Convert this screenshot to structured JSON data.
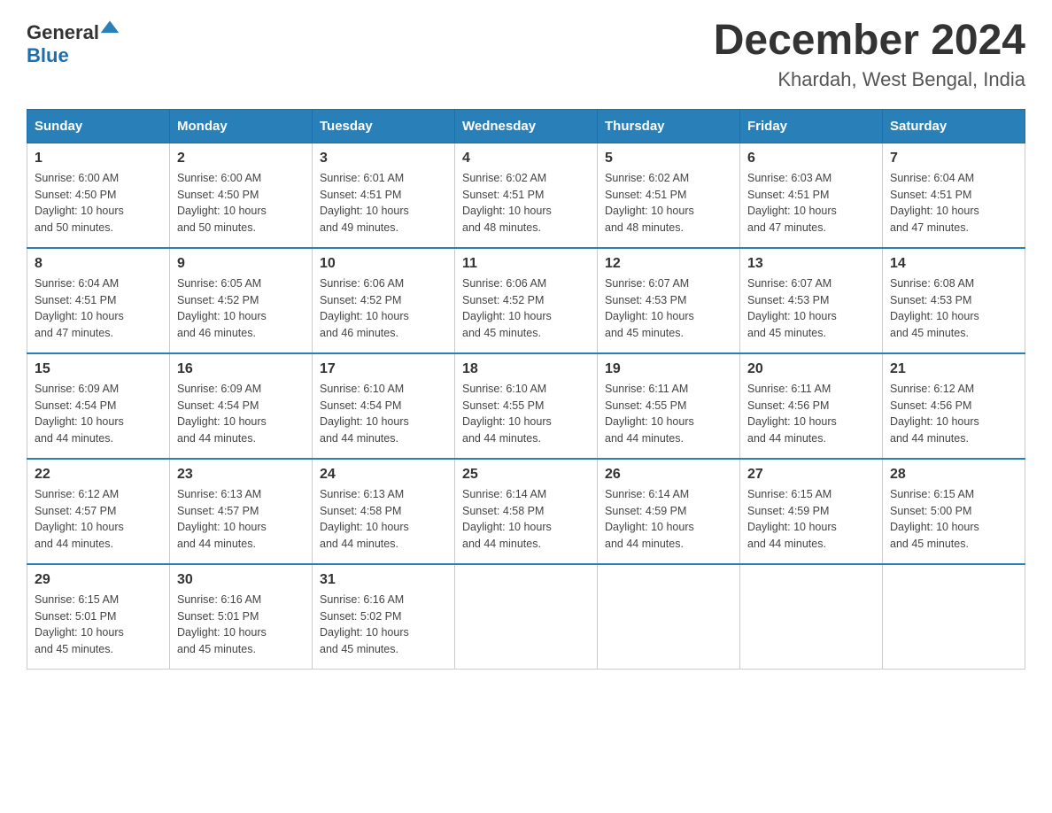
{
  "logo": {
    "general": "General",
    "blue": "Blue"
  },
  "title": "December 2024",
  "location": "Khardah, West Bengal, India",
  "weekdays": [
    "Sunday",
    "Monday",
    "Tuesday",
    "Wednesday",
    "Thursday",
    "Friday",
    "Saturday"
  ],
  "weeks": [
    [
      {
        "day": "1",
        "sunrise": "6:00 AM",
        "sunset": "4:50 PM",
        "daylight": "10 hours and 50 minutes."
      },
      {
        "day": "2",
        "sunrise": "6:00 AM",
        "sunset": "4:50 PM",
        "daylight": "10 hours and 50 minutes."
      },
      {
        "day": "3",
        "sunrise": "6:01 AM",
        "sunset": "4:51 PM",
        "daylight": "10 hours and 49 minutes."
      },
      {
        "day": "4",
        "sunrise": "6:02 AM",
        "sunset": "4:51 PM",
        "daylight": "10 hours and 48 minutes."
      },
      {
        "day": "5",
        "sunrise": "6:02 AM",
        "sunset": "4:51 PM",
        "daylight": "10 hours and 48 minutes."
      },
      {
        "day": "6",
        "sunrise": "6:03 AM",
        "sunset": "4:51 PM",
        "daylight": "10 hours and 47 minutes."
      },
      {
        "day": "7",
        "sunrise": "6:04 AM",
        "sunset": "4:51 PM",
        "daylight": "10 hours and 47 minutes."
      }
    ],
    [
      {
        "day": "8",
        "sunrise": "6:04 AM",
        "sunset": "4:51 PM",
        "daylight": "10 hours and 47 minutes."
      },
      {
        "day": "9",
        "sunrise": "6:05 AM",
        "sunset": "4:52 PM",
        "daylight": "10 hours and 46 minutes."
      },
      {
        "day": "10",
        "sunrise": "6:06 AM",
        "sunset": "4:52 PM",
        "daylight": "10 hours and 46 minutes."
      },
      {
        "day": "11",
        "sunrise": "6:06 AM",
        "sunset": "4:52 PM",
        "daylight": "10 hours and 45 minutes."
      },
      {
        "day": "12",
        "sunrise": "6:07 AM",
        "sunset": "4:53 PM",
        "daylight": "10 hours and 45 minutes."
      },
      {
        "day": "13",
        "sunrise": "6:07 AM",
        "sunset": "4:53 PM",
        "daylight": "10 hours and 45 minutes."
      },
      {
        "day": "14",
        "sunrise": "6:08 AM",
        "sunset": "4:53 PM",
        "daylight": "10 hours and 45 minutes."
      }
    ],
    [
      {
        "day": "15",
        "sunrise": "6:09 AM",
        "sunset": "4:54 PM",
        "daylight": "10 hours and 44 minutes."
      },
      {
        "day": "16",
        "sunrise": "6:09 AM",
        "sunset": "4:54 PM",
        "daylight": "10 hours and 44 minutes."
      },
      {
        "day": "17",
        "sunrise": "6:10 AM",
        "sunset": "4:54 PM",
        "daylight": "10 hours and 44 minutes."
      },
      {
        "day": "18",
        "sunrise": "6:10 AM",
        "sunset": "4:55 PM",
        "daylight": "10 hours and 44 minutes."
      },
      {
        "day": "19",
        "sunrise": "6:11 AM",
        "sunset": "4:55 PM",
        "daylight": "10 hours and 44 minutes."
      },
      {
        "day": "20",
        "sunrise": "6:11 AM",
        "sunset": "4:56 PM",
        "daylight": "10 hours and 44 minutes."
      },
      {
        "day": "21",
        "sunrise": "6:12 AM",
        "sunset": "4:56 PM",
        "daylight": "10 hours and 44 minutes."
      }
    ],
    [
      {
        "day": "22",
        "sunrise": "6:12 AM",
        "sunset": "4:57 PM",
        "daylight": "10 hours and 44 minutes."
      },
      {
        "day": "23",
        "sunrise": "6:13 AM",
        "sunset": "4:57 PM",
        "daylight": "10 hours and 44 minutes."
      },
      {
        "day": "24",
        "sunrise": "6:13 AM",
        "sunset": "4:58 PM",
        "daylight": "10 hours and 44 minutes."
      },
      {
        "day": "25",
        "sunrise": "6:14 AM",
        "sunset": "4:58 PM",
        "daylight": "10 hours and 44 minutes."
      },
      {
        "day": "26",
        "sunrise": "6:14 AM",
        "sunset": "4:59 PM",
        "daylight": "10 hours and 44 minutes."
      },
      {
        "day": "27",
        "sunrise": "6:15 AM",
        "sunset": "4:59 PM",
        "daylight": "10 hours and 44 minutes."
      },
      {
        "day": "28",
        "sunrise": "6:15 AM",
        "sunset": "5:00 PM",
        "daylight": "10 hours and 45 minutes."
      }
    ],
    [
      {
        "day": "29",
        "sunrise": "6:15 AM",
        "sunset": "5:01 PM",
        "daylight": "10 hours and 45 minutes."
      },
      {
        "day": "30",
        "sunrise": "6:16 AM",
        "sunset": "5:01 PM",
        "daylight": "10 hours and 45 minutes."
      },
      {
        "day": "31",
        "sunrise": "6:16 AM",
        "sunset": "5:02 PM",
        "daylight": "10 hours and 45 minutes."
      },
      null,
      null,
      null,
      null
    ]
  ],
  "labels": {
    "sunrise": "Sunrise:",
    "sunset": "Sunset:",
    "daylight": "Daylight:"
  }
}
